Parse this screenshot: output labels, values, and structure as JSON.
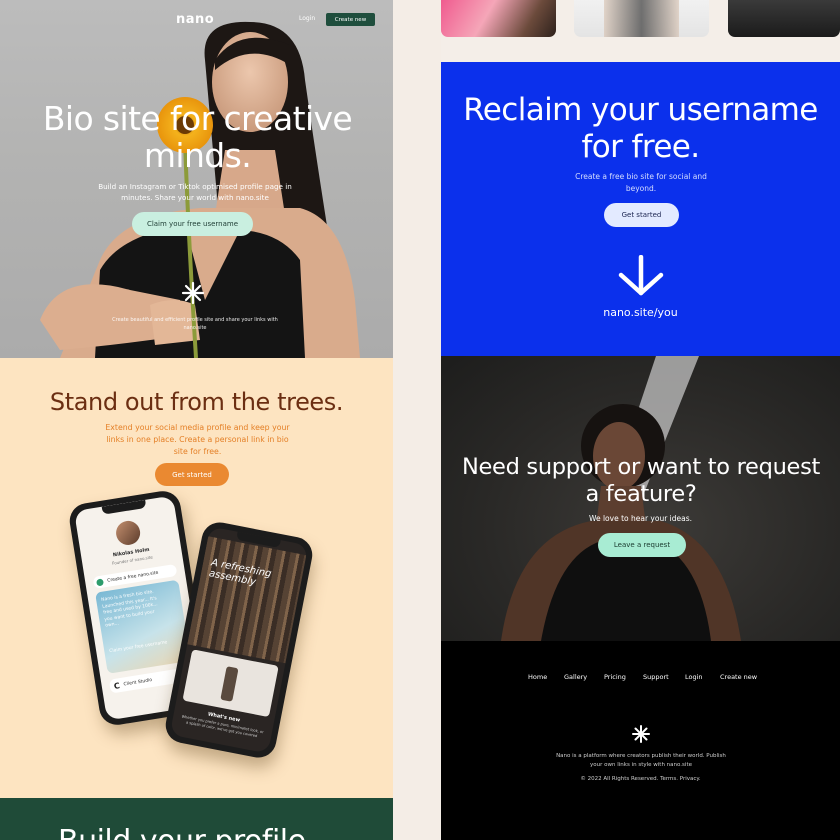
{
  "left": {
    "nav": {
      "logo": "nano",
      "login": "Login",
      "create": "Create new"
    },
    "hero": {
      "title": "Bio site for creative minds.",
      "subtitle": "Build an Instagram or Tiktok optimised profile page in minutes. Share your world with nano.site",
      "cta": "Claim your free username",
      "footnote": "Create beautiful and efficient profile site and share your links with nano.site"
    },
    "stand": {
      "title": "Stand out from the trees.",
      "subtitle": "Extend your social media profile and keep your links in one place. Create a personal link in bio site for free.",
      "cta": "Get started"
    },
    "phone1": {
      "name": "Nikolas Holm",
      "role": "Founder of nano.site",
      "card_label": "Create a free nano.site",
      "card_text": "Nano is a fresh bio site. Launched this year... It's free and used by 100k... you want to build your own...",
      "cta": "Claim your free username",
      "client": "Client Studio"
    },
    "phone2": {
      "headline": "A refreshing assembly",
      "caption_title": "What's new",
      "caption_text": "Whether you prefer a pure, minimalist look, or a splash of color, we've got you covered"
    },
    "build": {
      "title": "Build your profile"
    }
  },
  "right": {
    "blue": {
      "title": "Reclaim your username for free.",
      "subtitle": "Create a free bio site for social and beyond.",
      "cta": "Get started",
      "url": "nano.site/you"
    },
    "support": {
      "title": "Need support or want to request a feature?",
      "subtitle": "We love to hear your ideas.",
      "cta": "Leave a request"
    },
    "footer": {
      "nav": [
        "Home",
        "Gallery",
        "Pricing",
        "Support",
        "Login",
        "Create new"
      ],
      "description": "Nano is a platform where creators publish their world. Publish your own links in style with nano.site",
      "copyright": "© 2022 All Rights Reserved. Terms. Privacy."
    }
  },
  "colors": {
    "brand_green": "#1f4e3d",
    "mint": "#c9efe0",
    "peach": "#fde4c1",
    "orange": "#ea8931",
    "brown": "#6b2e12",
    "blue": "#0b30ec",
    "black": "#000000"
  },
  "icons": [
    "asterisk-logo-icon",
    "arrow-down-icon"
  ]
}
